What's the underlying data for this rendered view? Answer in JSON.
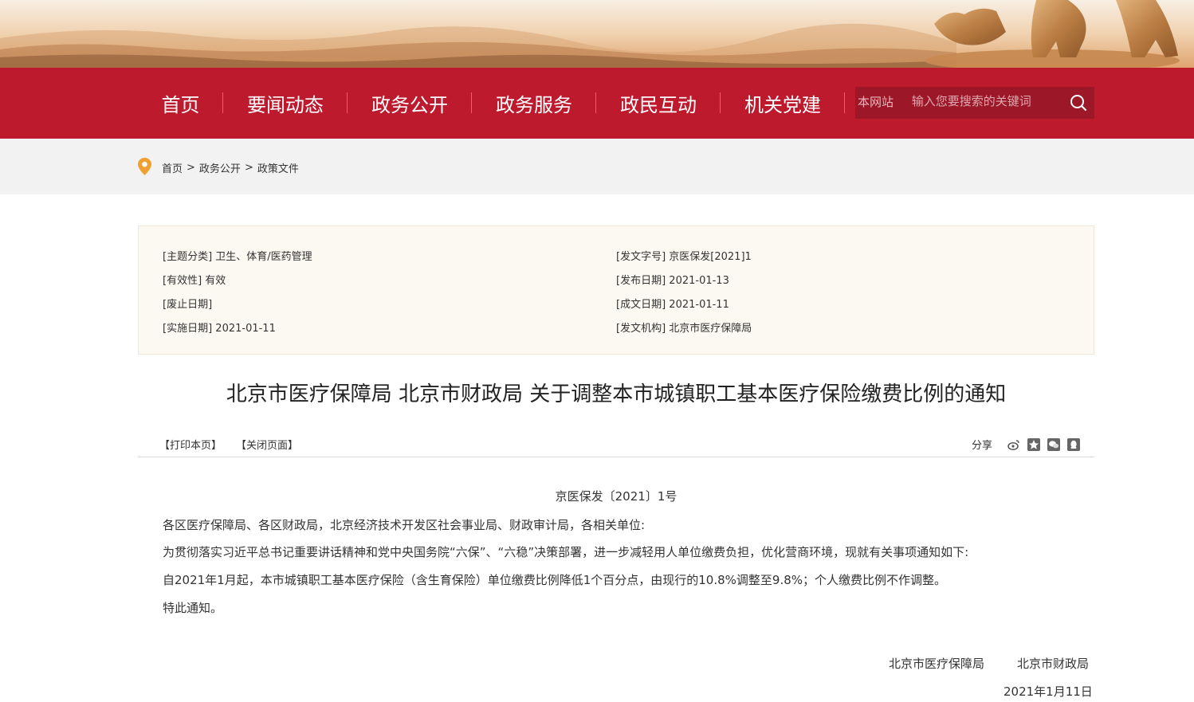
{
  "nav": {
    "items": [
      "首页",
      "要闻动态",
      "政务公开",
      "政务服务",
      "政民互动",
      "机关党建"
    ],
    "search_scope": "本网站",
    "search_placeholder": "输入您要搜索的关键词"
  },
  "breadcrumb": {
    "items": [
      "首页",
      "政务公开",
      "政策文件"
    ],
    "separator": ">"
  },
  "meta": {
    "left": [
      {
        "key": "[主题分类]",
        "value": "卫生、体育/医药管理"
      },
      {
        "key": "[有效性]",
        "value": "有效"
      },
      {
        "key": "[废止日期]",
        "value": ""
      },
      {
        "key": "[实施日期]",
        "value": "2021-01-11"
      }
    ],
    "right": [
      {
        "key": "[发文字号]",
        "value": "京医保发[2021]1"
      },
      {
        "key": "[发布日期]",
        "value": "2021-01-13"
      },
      {
        "key": "[成文日期]",
        "value": "2021-01-11"
      },
      {
        "key": "[发文机构]",
        "value": "北京市医疗保障局"
      }
    ]
  },
  "article": {
    "title": "北京市医疗保障局 北京市财政局 关于调整本市城镇职工基本医疗保险缴费比例的通知",
    "print_label": "【打印本页】",
    "close_label": "【关闭页面】",
    "share_label": "分享",
    "share_icons": [
      "weibo-icon",
      "qzone-icon",
      "wechat-icon",
      "qq-icon"
    ],
    "doc_number": "京医保发〔2021〕1号",
    "paragraphs": [
      "各区医疗保障局、各区财政局，北京经济技术开发区社会事业局、财政审计局，各相关单位:",
      "为贯彻落实习近平总书记重要讲话精神和党中央国务院“六保”、“六稳”决策部署，进一步减轻用人单位缴费负担，优化营商环境，现就有关事项通知如下:",
      "自2021年1月起，本市城镇职工基本医疗保险（含生育保险）单位缴费比例降低1个百分点，由现行的10.8%调整至9.8%；个人缴费比例不作调整。",
      "特此通知。"
    ],
    "signers": [
      "北京市医疗保障局",
      "北京市财政局"
    ],
    "date": "2021年1月11日"
  },
  "colors": {
    "nav_red": "#bd1a2e",
    "search_bg": "#9c1727",
    "pin_orange": "#f0a030",
    "info_bg": "#fcf9f3"
  }
}
